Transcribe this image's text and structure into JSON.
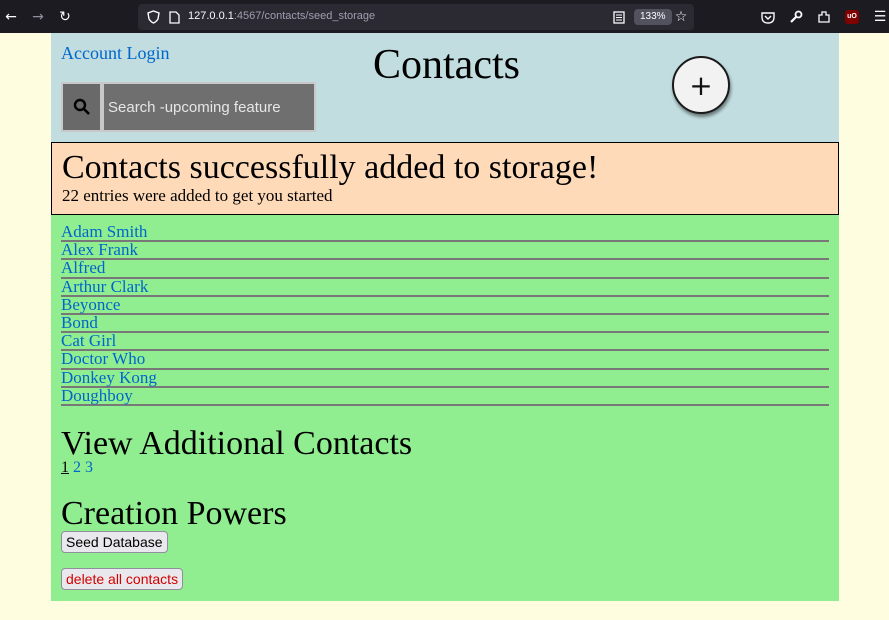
{
  "browser": {
    "url_host": "127.0.0.1",
    "url_path": ":4567/contacts/seed_storage",
    "zoom": "133%",
    "ublock_label": "uO"
  },
  "header": {
    "account_login": "Account Login",
    "title": "Contacts",
    "add_label": "+",
    "search_placeholder": "Search -upcoming feature"
  },
  "flash": {
    "title": "Contacts successfully added to storage!",
    "subtitle": "22 entries were added to get you started"
  },
  "contacts": [
    "Adam Smith",
    "Alex Frank",
    "Alfred",
    "Arthur Clark",
    "Beyonce",
    "Bond",
    "Cat Girl",
    "Doctor Who",
    "Donkey Kong",
    "Doughboy"
  ],
  "additional": {
    "heading": "View Additional Contacts",
    "pages": [
      "1",
      "2",
      "3"
    ],
    "current_page": "1"
  },
  "creation": {
    "heading": "Creation Powers",
    "seed_button": "Seed Database",
    "delete_button": "delete all contacts"
  },
  "colors": {
    "header_bg": "#c1dddf",
    "flash_bg": "#ffdab9",
    "page_bg": "#90ee90",
    "link": "#0066cc",
    "delete": "#d40000"
  }
}
